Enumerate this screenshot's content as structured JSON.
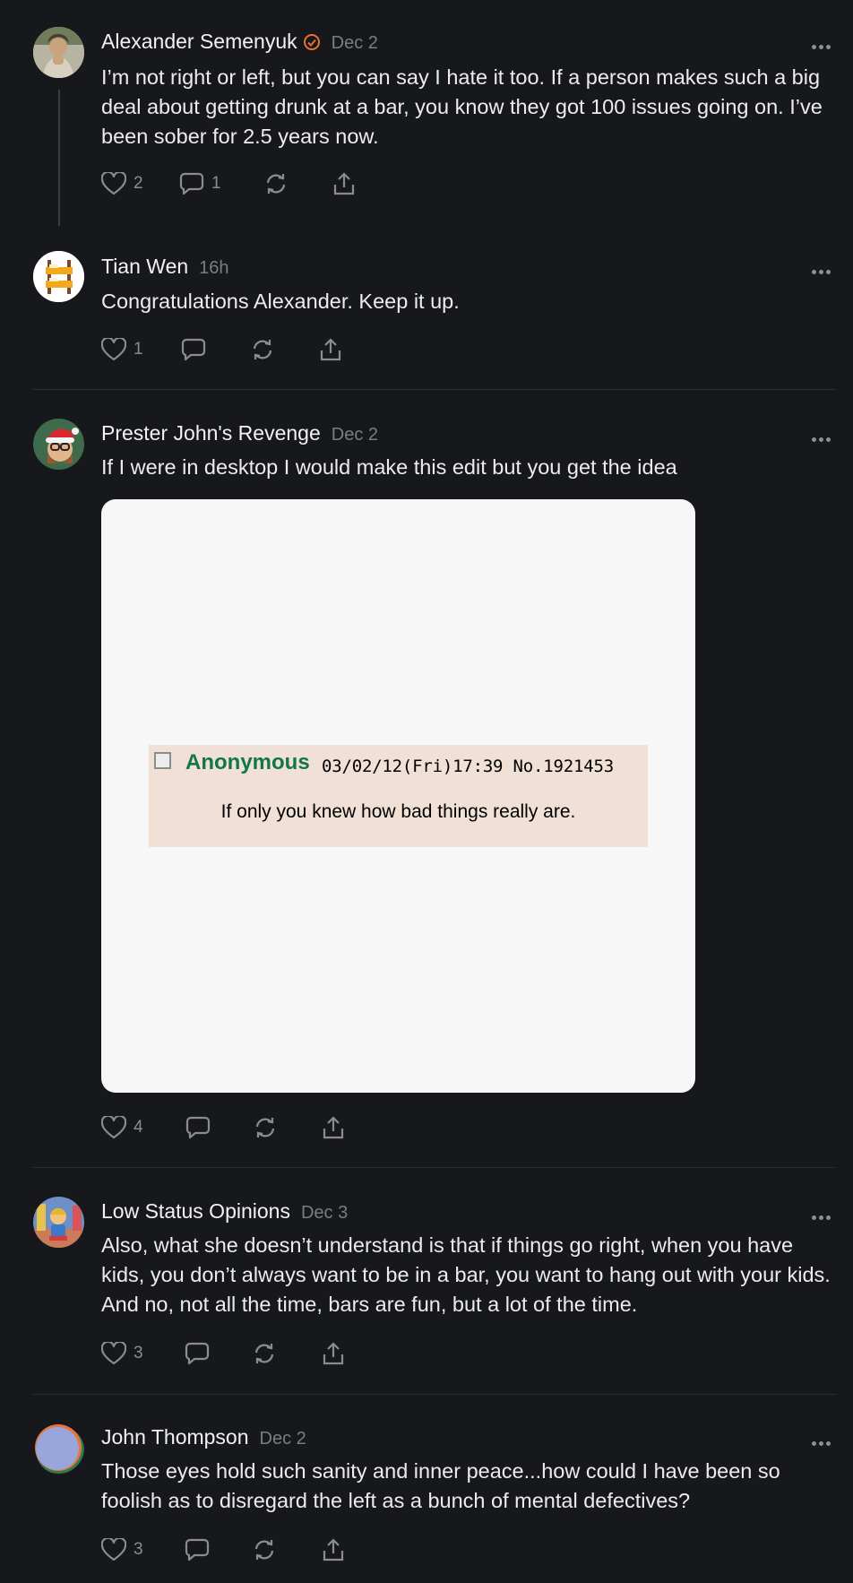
{
  "posts": [
    {
      "author": "Alexander Semenyuk",
      "verified": true,
      "date": "Dec 2",
      "text": "I’m not right or left, but you can say I hate it too. If a person makes such a big deal about getting drunk at a bar, you know they got 100 issues going on. I’ve been sober for 2.5 years now.",
      "likes": "2",
      "comments": "1",
      "reposts": "",
      "avatar_color": "#9a8c74"
    },
    {
      "author": "Tian Wen",
      "date": "16h",
      "text": "Congratulations Alexander. Keep it up.",
      "likes": "1",
      "comments": "",
      "avatar_color": "#ffffff"
    },
    {
      "author": "Prester John's Revenge",
      "date": "Dec 2",
      "text": "If I were in desktop I would make this edit but you get the idea",
      "likes": "4",
      "comments": "",
      "avatar_color": "#3f6b4d",
      "image": {
        "poster": "Anonymous",
        "meta": "03/02/12(Fri)17:39 No.1921453",
        "message": "If only you knew how bad things really are."
      }
    },
    {
      "author": "Low Status Opinions",
      "date": "Dec 3",
      "text": "Also, what she doesn’t understand is that if things go right, when you have kids, you don’t always want to be in a bar, you want to hang out with your kids. And no, not all the time, bars are fun, but a lot of the time.",
      "likes": "3",
      "comments": "",
      "avatar_color": "#5d7fb8"
    },
    {
      "author": "John Thompson",
      "date": "Dec 2",
      "text": "Those eyes hold such sanity and inner peace...how could I have been so foolish as to disregard the left as a bunch of mental defectives?",
      "likes": "3",
      "comments": "",
      "avatar_color": "#98a6dc"
    }
  ],
  "colors": {
    "background": "#17181b",
    "verified_badge": "#ef6f2e",
    "muted": "#8a8c91",
    "anon_green": "#117743",
    "chan_post_bg": "#f0e0d6"
  }
}
